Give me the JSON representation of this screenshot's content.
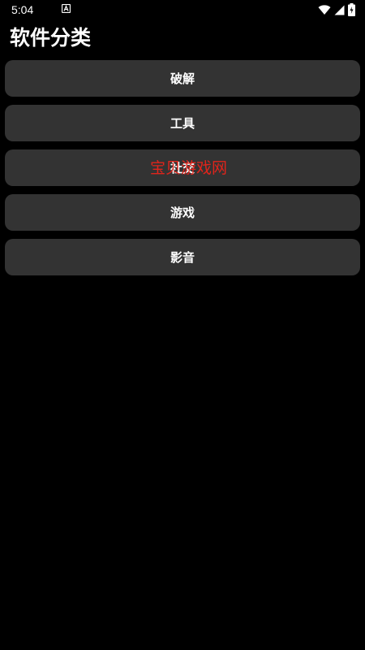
{
  "status_bar": {
    "time": "5:04"
  },
  "header": {
    "title": "软件分类"
  },
  "categories": [
    {
      "label": "破解"
    },
    {
      "label": "工具"
    },
    {
      "label": "社交"
    },
    {
      "label": "游戏"
    },
    {
      "label": "影音"
    }
  ],
  "watermark": {
    "text": "宝贝游戏网",
    "color": "#e0241b"
  },
  "colors": {
    "background": "#000000",
    "button": "#333333",
    "text": "#ffffff"
  }
}
